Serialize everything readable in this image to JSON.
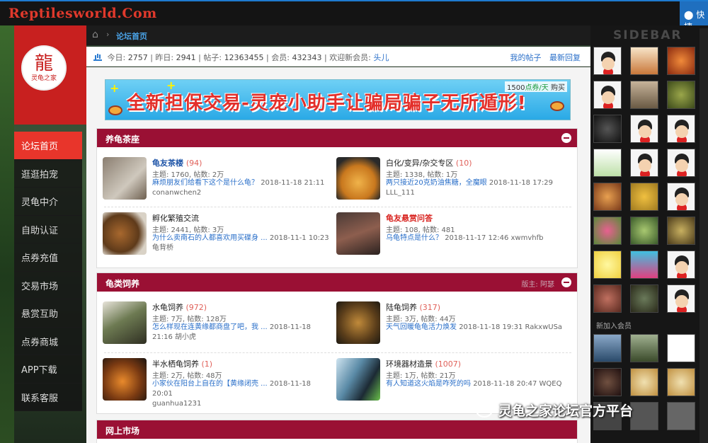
{
  "site": {
    "logo_text": "Reptilesworld.Com",
    "quick_label": "快捷",
    "logo_caption": "灵龟之家"
  },
  "breadcrumb": {
    "current": "论坛首页"
  },
  "stats": {
    "today_label": "今日:",
    "today": "2757",
    "yesterday_label": "昨日:",
    "yesterday": "2941",
    "posts_label": "帖子:",
    "posts": "12363455",
    "members_label": "会员:",
    "members": "432343",
    "welcome_label": "欢迎新会员:",
    "new_member": "头儿",
    "my_posts": "我的帖子",
    "latest_replies": "最新回复"
  },
  "banner": {
    "text": "全新担保交易-灵宠小助手让骗局骗子无所遁形!",
    "price_num": "1500",
    "price_unit": "点券/天",
    "buy": "购买"
  },
  "sections": [
    {
      "title": "养龟茶座",
      "forums": [
        {
          "name": "龟友茶楼",
          "count": "(94)",
          "meta": "主题: 1760, 帖数: 2万",
          "last_title": "麻烦朋友们给看下这个是什么龟？",
          "last_time": "2018-11-18 21:11",
          "last_user": "conanwchen2"
        },
        {
          "name": "白化/变异/杂交专区",
          "count": "(10)",
          "meta": "主题: 1338, 帖数: 1万",
          "last_title": "两只接近20克奶油焦糖，全魔眼",
          "last_time": "2018-11-18 17:29",
          "last_user": "LLL_111"
        },
        {
          "name": "孵化繁殖交流",
          "count": "",
          "meta": "主题: 2441, 帖数: 3万",
          "last_title": "为什么卖南石的人都喜欢用买碟身 ...",
          "last_time": "2018-11-1 10:23",
          "last_user": "龟背桥"
        },
        {
          "name": "龟友悬赏问答",
          "count": "",
          "meta": "主题: 108, 帖数: 481",
          "last_title": "乌龟特点是什么？",
          "last_time": "2018-11-17 12:46",
          "last_user": "xwmvhfb"
        }
      ]
    },
    {
      "title": "龟类饲养",
      "moderator": "版主: 阿瑟",
      "forums": [
        {
          "name": "水龟饲养",
          "count": "(972)",
          "meta": "主题: 7万, 帖数: 128万",
          "last_title": "怎么样现在连黄缘都商盘了吧，我 ...",
          "last_time": "2018-11-18 21:16",
          "last_user": "胡小虎"
        },
        {
          "name": "陆龟饲养",
          "count": "(317)",
          "meta": "主题: 3万, 帖数: 44万",
          "last_title": "天气回暖龟龟活力焕发",
          "last_time": "2018-11-18 19:31",
          "last_user": "RakxwUSa"
        },
        {
          "name": "半水栖龟饲养",
          "count": "(1)",
          "meta": "主题: 2万, 帖数: 48万",
          "last_title": "小家伙在阳台上自在的【黄缘闭壳 ...",
          "last_time": "2018-11-18 20:01",
          "last_user": "guanhua1231"
        },
        {
          "name": "环境器材造景",
          "count": "(1007)",
          "meta": "主题: 1万, 帖数: 21万",
          "last_title": "有人知道这火焰是咋死的吗",
          "last_time": "2018-11-18 20:47",
          "last_user": "WQEQ"
        }
      ]
    },
    {
      "title": "网上市场"
    }
  ],
  "nav": [
    "论坛首页",
    "逛逛拍宠",
    "灵龟中介",
    "自助认证",
    "点券充值",
    "交易市场",
    "悬赏互助",
    "点券商城",
    "APP下载",
    "联系客服"
  ],
  "sidebar": {
    "title": "SIDEBAR",
    "new_members_label": "新加入会员"
  },
  "watermark": "灵龟之家论坛官方平台",
  "colors": {
    "accent_red": "#e8352b",
    "section_header": "#9a1034",
    "link_blue": "#1f55a8",
    "topbar_accent": "#1e7bd0"
  }
}
